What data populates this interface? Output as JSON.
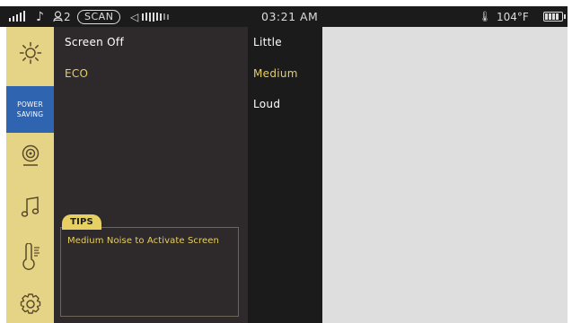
{
  "status_bar": {
    "user_count": "2",
    "scan_label": "SCAN",
    "time": "03:21 AM",
    "temperature": "104°F",
    "icons": [
      "signal-icon",
      "music-note-icon",
      "users-icon",
      "volume-icon",
      "thermometer-icon",
      "battery-icon"
    ]
  },
  "sidebar": {
    "items": [
      {
        "name": "brightness",
        "icon": "brightness-icon"
      },
      {
        "name": "power-saving",
        "label_line1": "POWER",
        "label_line2": "SAVING",
        "selected": true
      },
      {
        "name": "webcam",
        "icon": "webcam-icon"
      },
      {
        "name": "music",
        "icon": "music-icon"
      },
      {
        "name": "temperature",
        "icon": "thermometer-icon"
      },
      {
        "name": "settings",
        "icon": "gear-icon"
      }
    ]
  },
  "options": [
    {
      "label": "Screen Off",
      "selected": false
    },
    {
      "label": "ECO",
      "selected": true
    }
  ],
  "levels": [
    {
      "label": "Little",
      "selected": false
    },
    {
      "label": "Medium",
      "selected": true
    },
    {
      "label": "Loud",
      "selected": false
    }
  ],
  "tips": {
    "title": "TIPS",
    "text": "Medium Noise to Activate Screen"
  },
  "colors": {
    "accent_yellow": "#e6cf63",
    "sidebar_bg": "#e6d486",
    "selected_blue": "#2f64b1",
    "panel_bg": "#2e292b",
    "dark_bg": "#1b1b1b",
    "content_bg": "#dedede"
  }
}
